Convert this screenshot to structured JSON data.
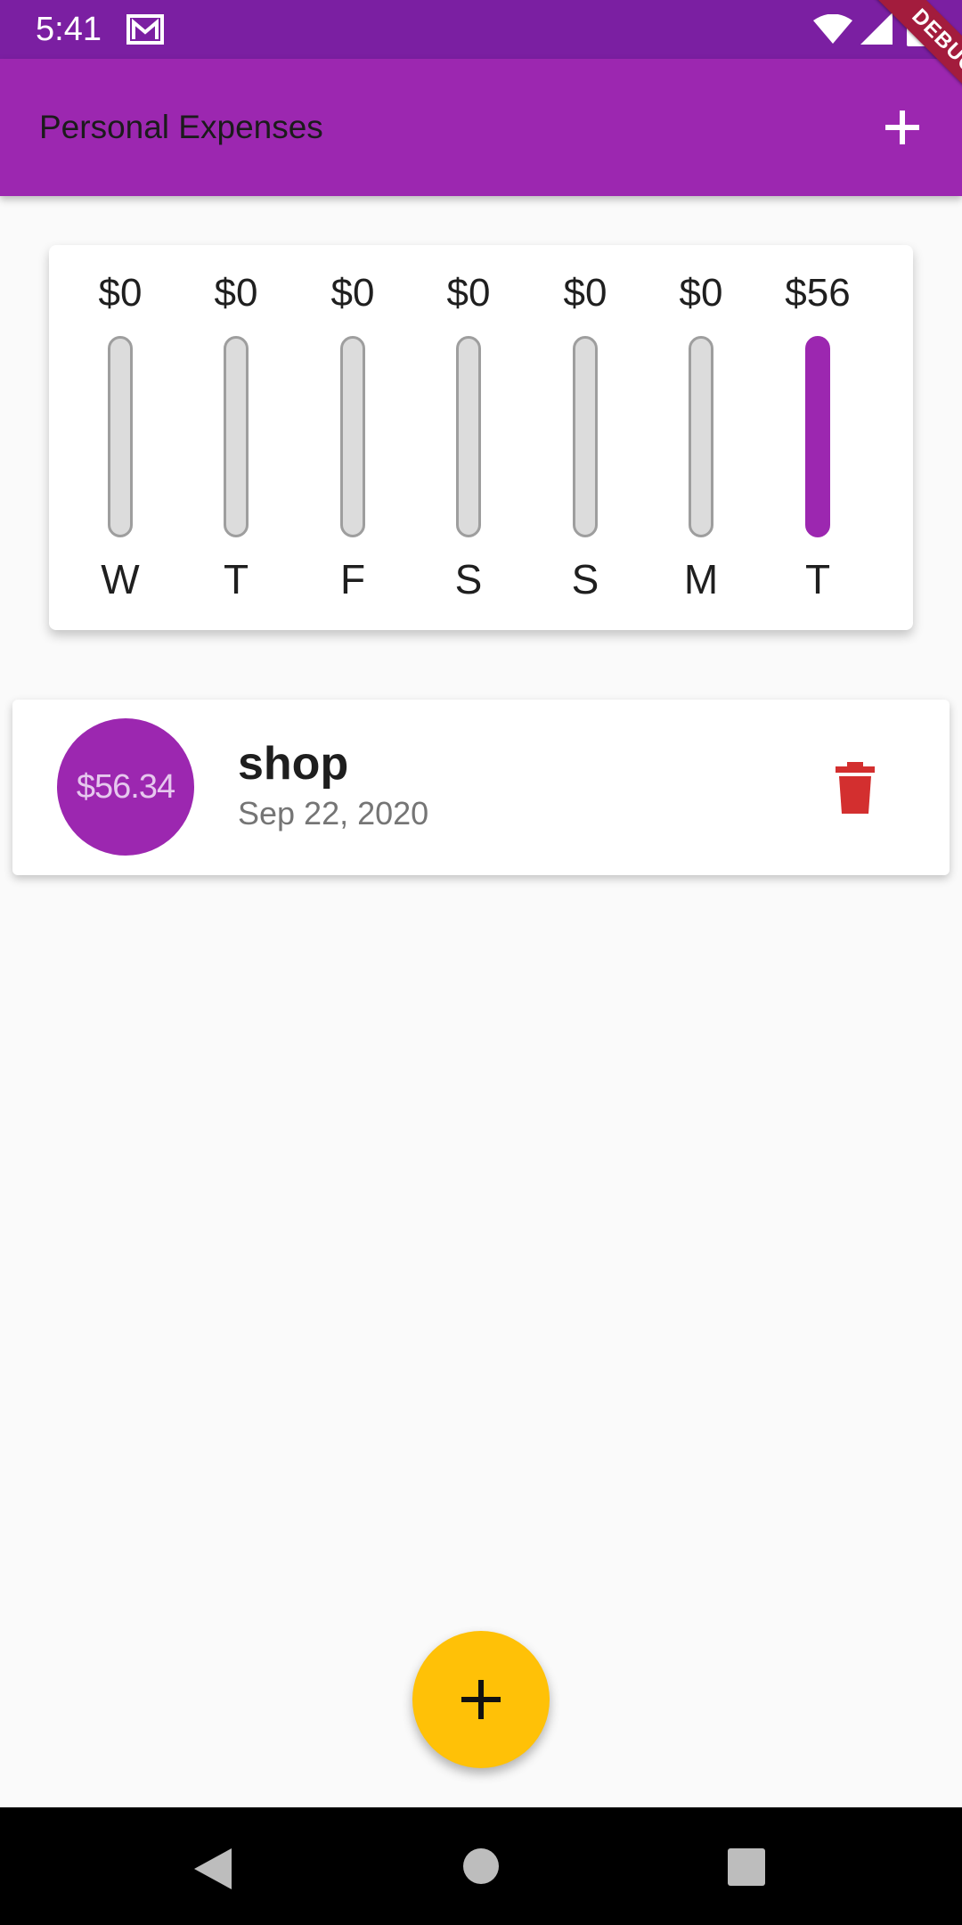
{
  "status_bar": {
    "time": "5:41",
    "icons": [
      "mail-icon",
      "wifi-icon",
      "signal-icon",
      "battery-icon"
    ]
  },
  "app_bar": {
    "title": "Personal Expenses",
    "add_icon": "plus-icon",
    "debug_label": "DEBUG"
  },
  "chart": {
    "bars": [
      {
        "day": "W",
        "amount": "$0",
        "fraction": 0
      },
      {
        "day": "T",
        "amount": "$0",
        "fraction": 0
      },
      {
        "day": "F",
        "amount": "$0",
        "fraction": 0
      },
      {
        "day": "S",
        "amount": "$0",
        "fraction": 0
      },
      {
        "day": "S",
        "amount": "$0",
        "fraction": 0
      },
      {
        "day": "M",
        "amount": "$0",
        "fraction": 0
      },
      {
        "day": "T",
        "amount": "$56",
        "fraction": 1
      }
    ]
  },
  "transactions": [
    {
      "amount": "$56.34",
      "title": "shop",
      "date": "Sep 22, 2020",
      "delete_icon": "trash-icon"
    }
  ],
  "fab": {
    "icon": "plus-icon"
  },
  "nav_bar": {
    "icons": [
      "back-icon",
      "home-icon",
      "recents-icon"
    ]
  },
  "colors": {
    "primary": "#9c27b0",
    "primary_dark": "#7b1fa2",
    "accent": "#ffc107",
    "delete": "#d32f2f",
    "bar_empty": "#dcdcdc"
  }
}
